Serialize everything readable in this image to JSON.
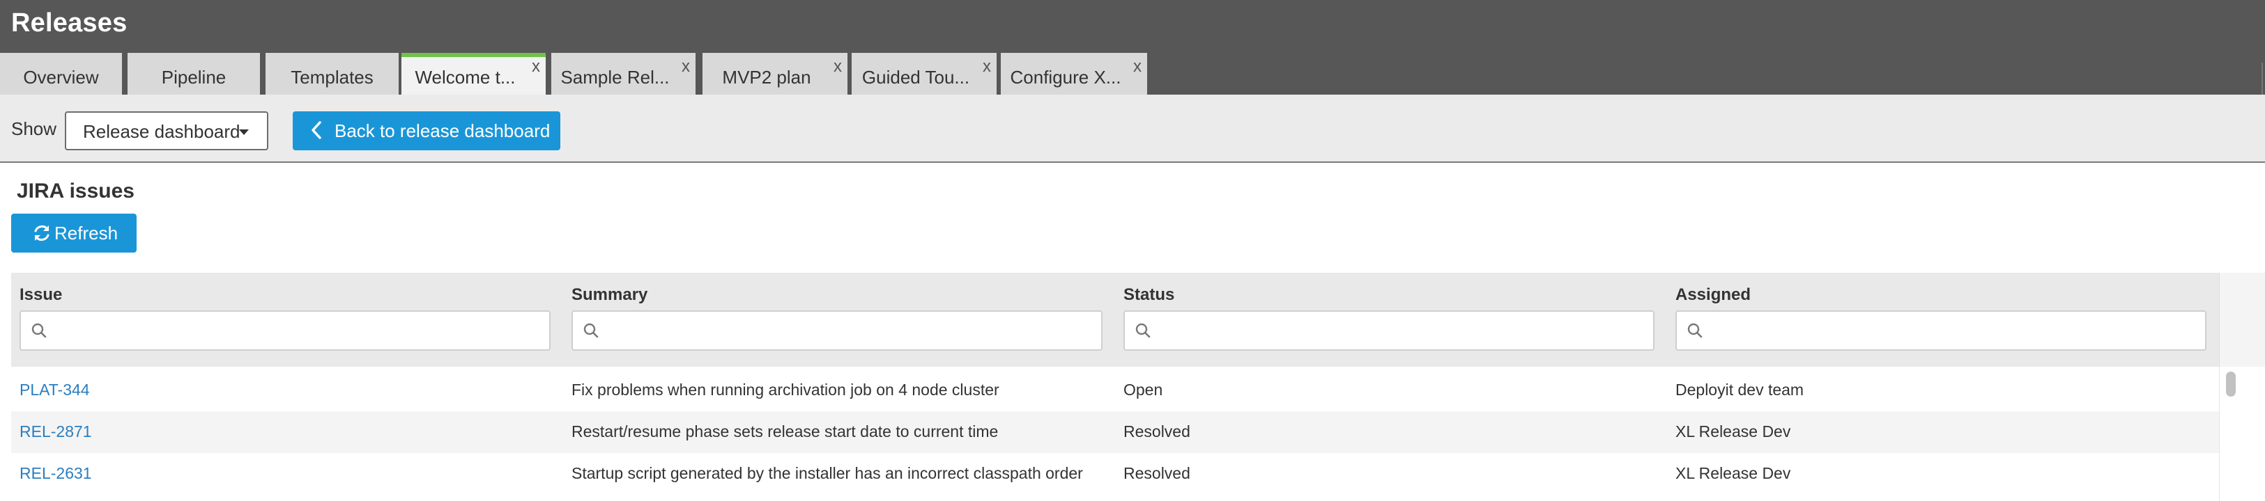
{
  "app": {
    "title": "Releases"
  },
  "tabs": [
    {
      "label": "Overview",
      "closable": false,
      "active": false
    },
    {
      "label": "Pipeline",
      "closable": false,
      "active": false
    },
    {
      "label": "Templates",
      "closable": false,
      "active": false
    },
    {
      "label": "Welcome t...",
      "closable": true,
      "active": true
    },
    {
      "label": "Sample Rel...",
      "closable": true,
      "active": false
    },
    {
      "label": "MVP2 plan",
      "closable": true,
      "active": false
    },
    {
      "label": "Guided Tou...",
      "closable": true,
      "active": false
    },
    {
      "label": "Configure X...",
      "closable": true,
      "active": false
    }
  ],
  "tab_close_glyph": "x",
  "toolbar": {
    "show_label": "Show",
    "dashboard_select": {
      "value": "Release dashboard"
    },
    "back_button": "Back to release dashboard"
  },
  "section": {
    "title": "JIRA issues",
    "refresh_button": "Refresh"
  },
  "table": {
    "columns": [
      {
        "label": "Issue",
        "filter_value": ""
      },
      {
        "label": "Summary",
        "filter_value": ""
      },
      {
        "label": "Status",
        "filter_value": ""
      },
      {
        "label": "Assigned",
        "filter_value": ""
      }
    ],
    "rows": [
      {
        "issue": "PLAT-344",
        "summary": "Fix problems when running archivation job on 4 node cluster",
        "status": "Open",
        "assigned": "Deployit dev team"
      },
      {
        "issue": "REL-2871",
        "summary": "Restart/resume phase sets release start date to current time",
        "status": "Resolved",
        "assigned": "XL Release Dev"
      },
      {
        "issue": "REL-2631",
        "summary": "Startup script generated by the installer has an incorrect classpath order",
        "status": "Resolved",
        "assigned": "XL Release Dev"
      }
    ]
  },
  "colors": {
    "header_bg": "#575757",
    "active_tab_accent": "#72c14b",
    "primary_button": "#1a96d8",
    "link": "#2a7ec0"
  },
  "icons": {
    "back": "chevron-left-icon",
    "refresh": "refresh-icon",
    "filter": "search-icon",
    "dropdown": "caret-down-icon"
  }
}
